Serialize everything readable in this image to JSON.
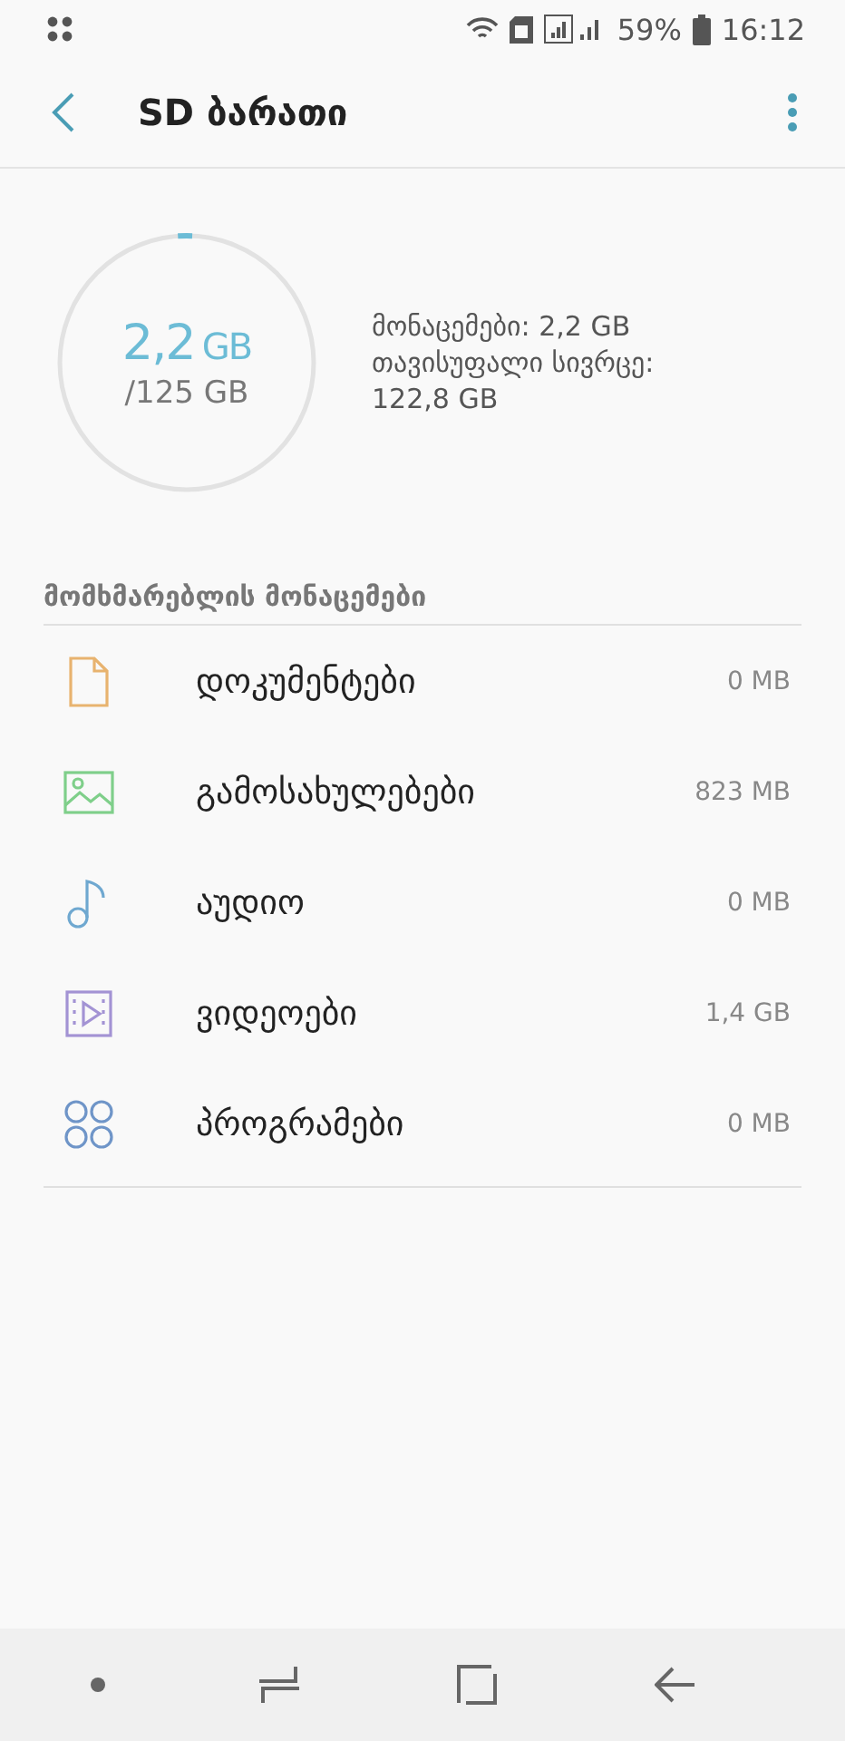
{
  "status_bar": {
    "battery": "59%",
    "time": "16:12"
  },
  "header": {
    "title": "SD ბარათი"
  },
  "storage": {
    "used": "2,2",
    "used_unit": "GB",
    "total": "/125 GB",
    "details": [
      "მონაცემები: 2,2 GB",
      "თავისუფალი სივრცე: 122,8 GB"
    ]
  },
  "section_title": "მომხმარებლის მონაცემები",
  "categories": [
    {
      "kind": "document",
      "color": "#e8b36f",
      "label": "დოკუმენტები",
      "size": "0 MB"
    },
    {
      "kind": "image",
      "color": "#7fcf8a",
      "label": "გამოსახულებები",
      "size": "823 MB"
    },
    {
      "kind": "audio",
      "color": "#6fa8d0",
      "label": "აუდიო",
      "size": "0 MB"
    },
    {
      "kind": "video",
      "color": "#a393d4",
      "label": "ვიდეოები",
      "size": "1,4 GB"
    },
    {
      "kind": "apps",
      "color": "#6f95c8",
      "label": "პროგრამები",
      "size": "0 MB"
    }
  ]
}
